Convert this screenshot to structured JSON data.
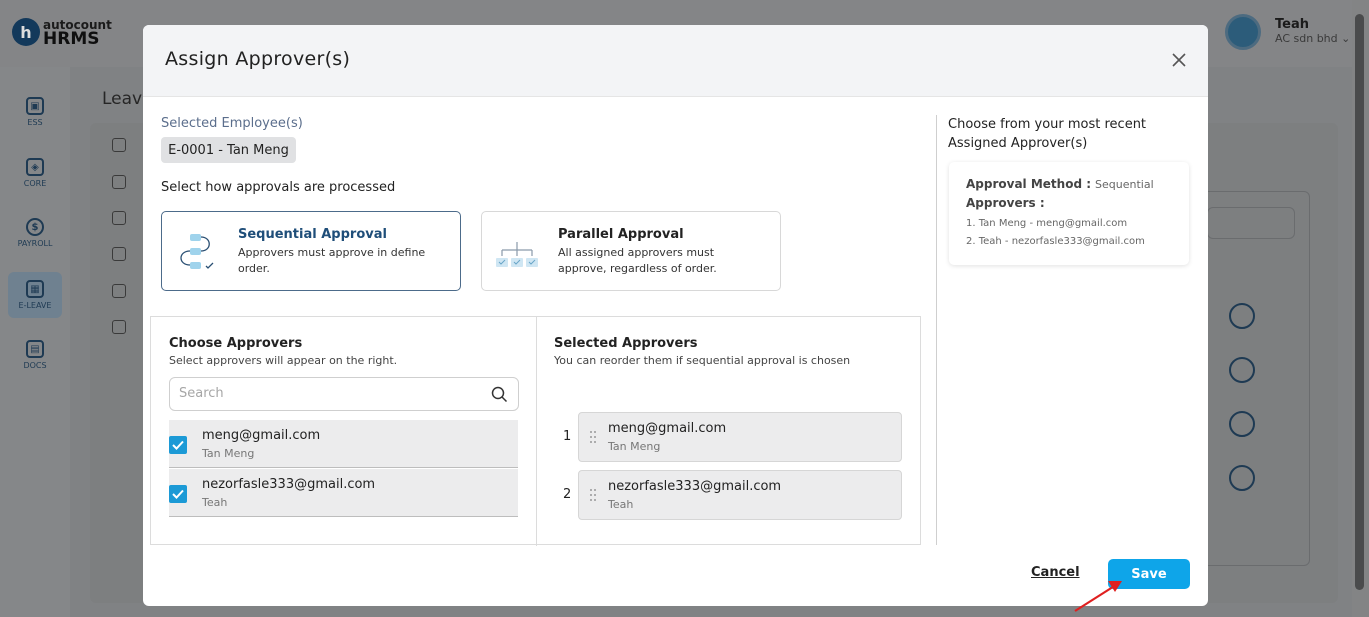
{
  "app": {
    "logo_letter": "h",
    "logo_small": "autocount",
    "logo_big": "HRMS",
    "user_name": "Teah",
    "user_company": "AC sdn bhd ⌄",
    "page_title": "Leave"
  },
  "sidebar": {
    "items": [
      {
        "label": "ESS",
        "icon": "id-card-icon"
      },
      {
        "label": "CORE",
        "icon": "cube-icon"
      },
      {
        "label": "PAYROLL",
        "icon": "dollar-icon"
      },
      {
        "label": "E-LEAVE",
        "icon": "calendar-icon",
        "active": true
      },
      {
        "label": "DOCS",
        "icon": "document-icon"
      }
    ]
  },
  "modal": {
    "title": "Assign Approver(s)",
    "selected_employees_label": "Selected Employee(s)",
    "selected_employee_chip": "E-0001 - Tan Meng",
    "process_label": "Select how approvals are processed",
    "methods": [
      {
        "title": "Sequential Approval",
        "desc": "Approvers must approve in define order.",
        "selected": true,
        "icon": "sequential-flow-icon"
      },
      {
        "title": "Parallel Approval",
        "desc": "All assigned approvers must approve, regardless of order.",
        "selected": false,
        "icon": "parallel-flow-icon"
      }
    ],
    "choose": {
      "title": "Choose Approvers",
      "subtitle": "Select approvers will appear on the right.",
      "search_placeholder": "Search",
      "options": [
        {
          "email": "meng@gmail.com",
          "name": "Tan Meng",
          "checked": true
        },
        {
          "email": "nezorfasle333@gmail.com",
          "name": "Teah",
          "checked": true
        }
      ]
    },
    "selected": {
      "title": "Selected Approvers",
      "subtitle": "You can reorder them if sequential approval is chosen",
      "items": [
        {
          "index": "1",
          "email": "meng@gmail.com",
          "name": "Tan Meng"
        },
        {
          "index": "2",
          "email": "nezorfasle333@gmail.com",
          "name": "Teah"
        }
      ]
    },
    "recent": {
      "title": "Choose from your most recent Assigned Approver(s)",
      "method_label": "Approval Method :",
      "method_value": "Sequential",
      "approvers_label": "Approvers :",
      "lines": [
        "1. Tan Meng - meng@gmail.com",
        "2. Teah - nezorfasle333@gmail.com"
      ]
    },
    "cancel_label": "Cancel",
    "save_label": "Save"
  },
  "colors": {
    "accent": "#0ea5e9",
    "checkbox": "#1c9ad6",
    "selected_border": "#4c6b8a",
    "arrow": "#e02020"
  }
}
